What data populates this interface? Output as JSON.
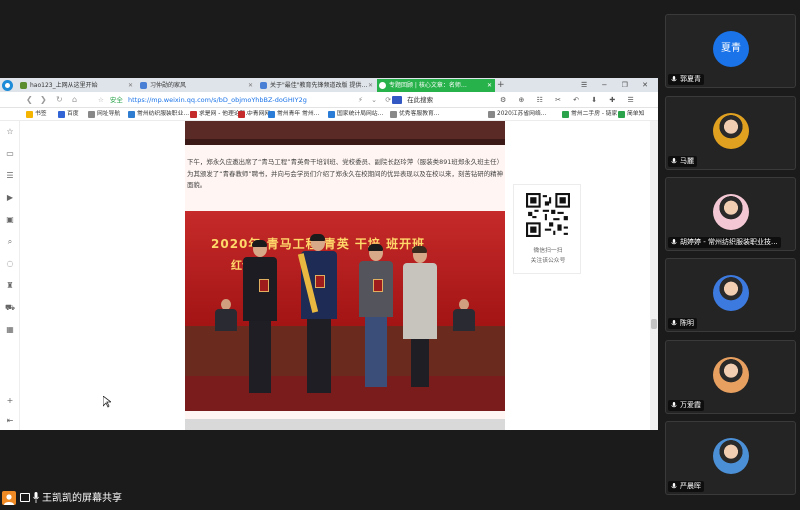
{
  "tabs": [
    {
      "label": "hao123_上网从这里开始",
      "icon_color": "#5c8d2f"
    },
    {
      "label": "习仲勋的家风",
      "icon_color": "#4a7fd6"
    },
    {
      "label": "关于\"最佳\"教育先锋频道改版 提供…",
      "icon_color": "#4a7fd6"
    },
    {
      "label": "专题回顾 | 核心文章：名师…",
      "icon_color": "#ffffff"
    }
  ],
  "new_tab_symbol": "+",
  "window_controls": "☰ − ❐ ✕",
  "address": {
    "safe_label": "安全",
    "url": "https://mp.weixin.qq.com/s/bD_objmoYhbBZ-doGHIY2g"
  },
  "search_placeholder": "在此搜索",
  "bookmarks": [
    {
      "label": "书签",
      "icon_color": "#f5b400"
    },
    {
      "label": "百度",
      "icon_color": "#3264d6"
    },
    {
      "label": "网址导航",
      "icon_color": "#888888"
    },
    {
      "label": "常州纺织服装职业…",
      "icon_color": "#2e7dd1"
    },
    {
      "label": "求是网 - 他理论新…",
      "icon_color": "#c62b2b"
    },
    {
      "label": "中青网网",
      "icon_color": "#c62b2b"
    },
    {
      "label": "常州青年 常州…",
      "icon_color": "#2b7cd6"
    },
    {
      "label": "国家统计局网站…",
      "icon_color": "#2b7cd6"
    },
    {
      "label": "优秀客服教育…",
      "icon_color": "#888888"
    },
    {
      "label": "2020江苏省网络…",
      "icon_color": "#888888"
    },
    {
      "label": "常州二手房 - 链家",
      "icon_color": "#2aa34a"
    },
    {
      "label": "简单知",
      "icon_color": "#2aa34a"
    }
  ],
  "article": {
    "paragraph": "下午，郑永久应邀出席了“青马工程”青英骨干培训班、党校委员、副院长赵玲萍（服装类891班郑永久班主任）为其颁发了“青春教师”聘书，并向与会学员们介绍了郑永久在校期间的优异表现以及在校以来，刻苦钻研的精神面貌。",
    "photo_banner_line1": "2020年  青马工程 青英  干培   班开班",
    "photo_banner_line2": "红色                                   式"
  },
  "qr": {
    "line1": "微信扫一扫",
    "line2": "关注该公众号"
  },
  "participants": [
    {
      "name": "郭夏青",
      "avatar_text": "夏青",
      "avatar_type": "text",
      "color": "#1a73e8"
    },
    {
      "name": "马麗",
      "avatar_type": "photo",
      "color": "#e0a020"
    },
    {
      "name": "胡婷婷 - 常州纺织服装职业技...",
      "avatar_type": "photo",
      "color": "#f3c7d3"
    },
    {
      "name": "陈明",
      "avatar_type": "photo",
      "color": "#3c7ae0"
    },
    {
      "name": "万爱霞",
      "avatar_type": "photo",
      "color": "#e8a060"
    },
    {
      "name": "严晨晖",
      "avatar_type": "photo",
      "color": "#4b8fd6"
    }
  ],
  "screen_share": {
    "label": "王凯凯的屏幕共享"
  }
}
